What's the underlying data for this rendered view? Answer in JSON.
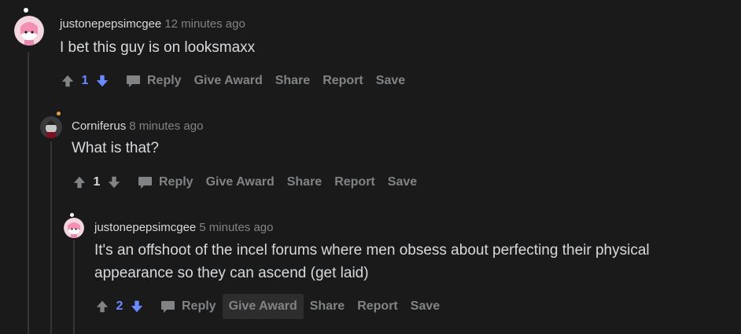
{
  "comments": [
    {
      "username": "justonepepsimcgee",
      "time": "12 minutes ago",
      "body": "I bet this guy is on looksmaxx",
      "votes": "1",
      "vote_state": "up",
      "actions": {
        "reply": "Reply",
        "give_award": "Give Award",
        "share": "Share",
        "report": "Report",
        "save": "Save"
      }
    },
    {
      "username": "Corniferus",
      "time": "8 minutes ago",
      "body": "What is that?",
      "votes": "1",
      "vote_state": "none",
      "actions": {
        "reply": "Reply",
        "give_award": "Give Award",
        "share": "Share",
        "report": "Report",
        "save": "Save"
      }
    },
    {
      "username": "justonepepsimcgee",
      "time": "5 minutes ago",
      "body_lines": [
        "It's an offshoot of the incel forums where men obsess about perfecting their physical",
        "appearance so they can ascend (get laid)"
      ],
      "votes": "2",
      "vote_state": "up",
      "actions": {
        "reply": "Reply",
        "give_award": "Give Award",
        "share": "Share",
        "report": "Report",
        "save": "Save"
      }
    }
  ],
  "colors": {
    "background": "#1a1a1b",
    "text": "#d7dadc",
    "muted": "#818384",
    "upvote_blue": "#6b8aff",
    "thread_line": "#343536"
  },
  "icons": {
    "upvote": "arrow-up-icon",
    "downvote": "arrow-down-icon",
    "reply": "speech-bubble-icon"
  }
}
